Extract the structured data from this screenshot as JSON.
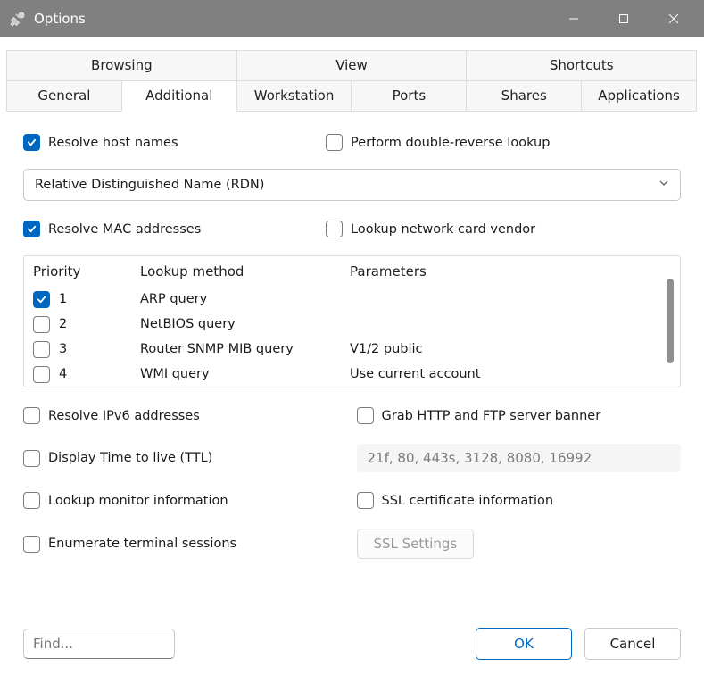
{
  "window": {
    "title": "Options"
  },
  "tabs": {
    "row1": [
      "Browsing",
      "View",
      "Shortcuts"
    ],
    "row2": [
      "General",
      "Additional",
      "Workstation",
      "Ports",
      "Shares",
      "Applications"
    ],
    "active": "Additional"
  },
  "options": {
    "resolve_host_names": {
      "label": "Resolve host names",
      "checked": true
    },
    "double_reverse": {
      "label": "Perform double-reverse lookup",
      "checked": false
    },
    "rdn_select": {
      "value": "Relative Distinguished Name (RDN)"
    },
    "resolve_mac": {
      "label": "Resolve MAC addresses",
      "checked": true
    },
    "lookup_vendor": {
      "label": "Lookup network card vendor",
      "checked": false
    },
    "resolve_ipv6": {
      "label": "Resolve IPv6 addresses",
      "checked": false
    },
    "grab_banner": {
      "label": "Grab HTTP and FTP server banner",
      "checked": false
    },
    "display_ttl": {
      "label": "Display Time to live (TTL)",
      "checked": false
    },
    "ports_field": {
      "value": "21f, 80, 443s, 3128, 8080, 16992"
    },
    "lookup_monitor": {
      "label": "Lookup monitor information",
      "checked": false
    },
    "ssl_cert": {
      "label": "SSL certificate information",
      "checked": false
    },
    "enum_terminal": {
      "label": "Enumerate terminal sessions",
      "checked": false
    },
    "ssl_settings_btn": "SSL Settings"
  },
  "listview": {
    "headers": {
      "priority": "Priority",
      "method": "Lookup method",
      "params": "Parameters"
    },
    "rows": [
      {
        "checked": true,
        "priority": "1",
        "method": "ARP query",
        "params": ""
      },
      {
        "checked": false,
        "priority": "2",
        "method": "NetBIOS query",
        "params": ""
      },
      {
        "checked": false,
        "priority": "3",
        "method": "Router SNMP MIB query",
        "params": "V1/2 public"
      },
      {
        "checked": false,
        "priority": "4",
        "method": "WMI query",
        "params": "Use current account"
      }
    ]
  },
  "footer": {
    "find_placeholder": "Find...",
    "ok": "OK",
    "cancel": "Cancel"
  }
}
